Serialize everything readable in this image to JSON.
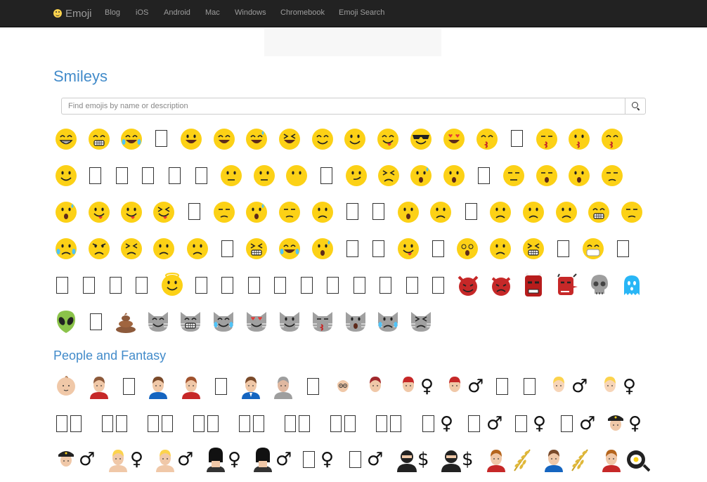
{
  "nav": {
    "brand": "Emoji",
    "links": [
      "Blog",
      "iOS",
      "Android",
      "Mac",
      "Windows",
      "Chromebook",
      "Emoji Search"
    ]
  },
  "sections": {
    "smileys_title": "Smileys",
    "people_title": "People and Fantasy"
  },
  "search": {
    "placeholder": "Find emojis by name or description"
  },
  "icons": {
    "brand": "smiley-icon",
    "search": "magnifier-icon",
    "missing_glyph": "tofu-box"
  },
  "colors": {
    "navbar_bg": "#222222",
    "nav_text": "#9d9d9d",
    "heading": "#428bca",
    "emoji_yellow": "#fcd116",
    "devil_red": "#c62828",
    "skull_gray": "#9e9e9e",
    "ghost_cyan": "#29b6f6",
    "alien_green": "#8bc34a",
    "cat_gray": "#a0a0a0"
  },
  "gender_signs": {
    "female": "♀",
    "male": "♂",
    "staff": "$"
  }
}
